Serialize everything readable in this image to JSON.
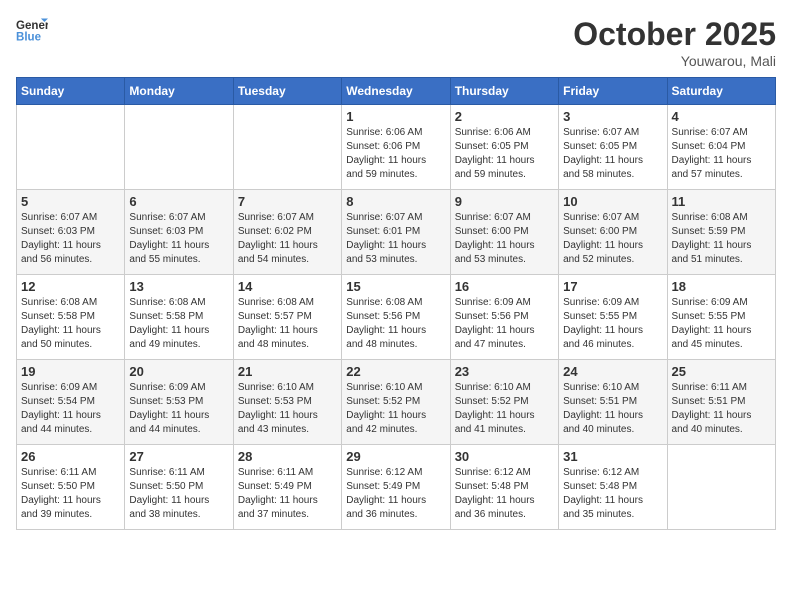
{
  "logo": {
    "line1": "General",
    "line2": "Blue"
  },
  "title": "October 2025",
  "location": "Youwarou, Mali",
  "days_of_week": [
    "Sunday",
    "Monday",
    "Tuesday",
    "Wednesday",
    "Thursday",
    "Friday",
    "Saturday"
  ],
  "weeks": [
    [
      {
        "day": "",
        "info": ""
      },
      {
        "day": "",
        "info": ""
      },
      {
        "day": "",
        "info": ""
      },
      {
        "day": "1",
        "info": "Sunrise: 6:06 AM\nSunset: 6:06 PM\nDaylight: 11 hours\nand 59 minutes."
      },
      {
        "day": "2",
        "info": "Sunrise: 6:06 AM\nSunset: 6:05 PM\nDaylight: 11 hours\nand 59 minutes."
      },
      {
        "day": "3",
        "info": "Sunrise: 6:07 AM\nSunset: 6:05 PM\nDaylight: 11 hours\nand 58 minutes."
      },
      {
        "day": "4",
        "info": "Sunrise: 6:07 AM\nSunset: 6:04 PM\nDaylight: 11 hours\nand 57 minutes."
      }
    ],
    [
      {
        "day": "5",
        "info": "Sunrise: 6:07 AM\nSunset: 6:03 PM\nDaylight: 11 hours\nand 56 minutes."
      },
      {
        "day": "6",
        "info": "Sunrise: 6:07 AM\nSunset: 6:03 PM\nDaylight: 11 hours\nand 55 minutes."
      },
      {
        "day": "7",
        "info": "Sunrise: 6:07 AM\nSunset: 6:02 PM\nDaylight: 11 hours\nand 54 minutes."
      },
      {
        "day": "8",
        "info": "Sunrise: 6:07 AM\nSunset: 6:01 PM\nDaylight: 11 hours\nand 53 minutes."
      },
      {
        "day": "9",
        "info": "Sunrise: 6:07 AM\nSunset: 6:00 PM\nDaylight: 11 hours\nand 53 minutes."
      },
      {
        "day": "10",
        "info": "Sunrise: 6:07 AM\nSunset: 6:00 PM\nDaylight: 11 hours\nand 52 minutes."
      },
      {
        "day": "11",
        "info": "Sunrise: 6:08 AM\nSunset: 5:59 PM\nDaylight: 11 hours\nand 51 minutes."
      }
    ],
    [
      {
        "day": "12",
        "info": "Sunrise: 6:08 AM\nSunset: 5:58 PM\nDaylight: 11 hours\nand 50 minutes."
      },
      {
        "day": "13",
        "info": "Sunrise: 6:08 AM\nSunset: 5:58 PM\nDaylight: 11 hours\nand 49 minutes."
      },
      {
        "day": "14",
        "info": "Sunrise: 6:08 AM\nSunset: 5:57 PM\nDaylight: 11 hours\nand 48 minutes."
      },
      {
        "day": "15",
        "info": "Sunrise: 6:08 AM\nSunset: 5:56 PM\nDaylight: 11 hours\nand 48 minutes."
      },
      {
        "day": "16",
        "info": "Sunrise: 6:09 AM\nSunset: 5:56 PM\nDaylight: 11 hours\nand 47 minutes."
      },
      {
        "day": "17",
        "info": "Sunrise: 6:09 AM\nSunset: 5:55 PM\nDaylight: 11 hours\nand 46 minutes."
      },
      {
        "day": "18",
        "info": "Sunrise: 6:09 AM\nSunset: 5:55 PM\nDaylight: 11 hours\nand 45 minutes."
      }
    ],
    [
      {
        "day": "19",
        "info": "Sunrise: 6:09 AM\nSunset: 5:54 PM\nDaylight: 11 hours\nand 44 minutes."
      },
      {
        "day": "20",
        "info": "Sunrise: 6:09 AM\nSunset: 5:53 PM\nDaylight: 11 hours\nand 44 minutes."
      },
      {
        "day": "21",
        "info": "Sunrise: 6:10 AM\nSunset: 5:53 PM\nDaylight: 11 hours\nand 43 minutes."
      },
      {
        "day": "22",
        "info": "Sunrise: 6:10 AM\nSunset: 5:52 PM\nDaylight: 11 hours\nand 42 minutes."
      },
      {
        "day": "23",
        "info": "Sunrise: 6:10 AM\nSunset: 5:52 PM\nDaylight: 11 hours\nand 41 minutes."
      },
      {
        "day": "24",
        "info": "Sunrise: 6:10 AM\nSunset: 5:51 PM\nDaylight: 11 hours\nand 40 minutes."
      },
      {
        "day": "25",
        "info": "Sunrise: 6:11 AM\nSunset: 5:51 PM\nDaylight: 11 hours\nand 40 minutes."
      }
    ],
    [
      {
        "day": "26",
        "info": "Sunrise: 6:11 AM\nSunset: 5:50 PM\nDaylight: 11 hours\nand 39 minutes."
      },
      {
        "day": "27",
        "info": "Sunrise: 6:11 AM\nSunset: 5:50 PM\nDaylight: 11 hours\nand 38 minutes."
      },
      {
        "day": "28",
        "info": "Sunrise: 6:11 AM\nSunset: 5:49 PM\nDaylight: 11 hours\nand 37 minutes."
      },
      {
        "day": "29",
        "info": "Sunrise: 6:12 AM\nSunset: 5:49 PM\nDaylight: 11 hours\nand 36 minutes."
      },
      {
        "day": "30",
        "info": "Sunrise: 6:12 AM\nSunset: 5:48 PM\nDaylight: 11 hours\nand 36 minutes."
      },
      {
        "day": "31",
        "info": "Sunrise: 6:12 AM\nSunset: 5:48 PM\nDaylight: 11 hours\nand 35 minutes."
      },
      {
        "day": "",
        "info": ""
      }
    ]
  ]
}
